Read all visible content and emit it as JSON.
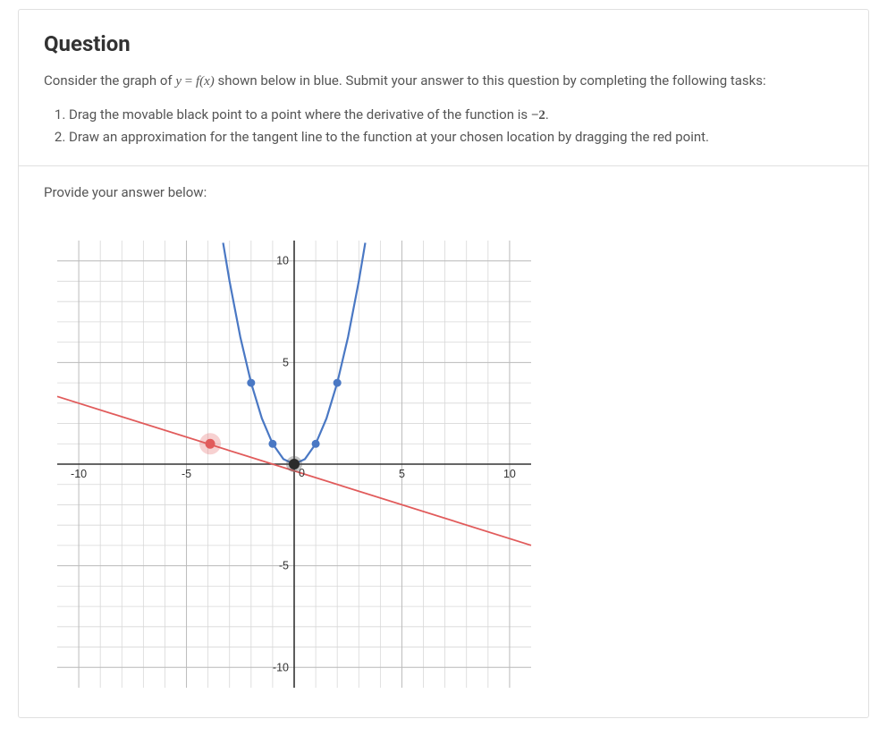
{
  "heading": "Question",
  "prompt_pre": "Consider the graph of ",
  "prompt_eq_lhs": "y",
  "prompt_eq_equals": " = ",
  "prompt_eq_rhs_f": "f",
  "prompt_eq_rhs_x": "(x)",
  "prompt_post": " shown below in blue. Submit your answer to this question by completing the following tasks:",
  "task1_pre": "Drag the movable black point to a point where the derivative of the function is ",
  "task1_val": "−2",
  "task1_post": ".",
  "task2": "Draw an approximation for the tangent line to the function at your chosen location by dragging the red point.",
  "provide": "Provide your answer below:",
  "chart_data": {
    "type": "line",
    "xlim": [
      -11,
      11
    ],
    "ylim": [
      -11,
      11
    ],
    "xticks_major": [
      -10,
      -5,
      0,
      5,
      10
    ],
    "yticks_major": [
      -10,
      -5,
      5,
      10
    ],
    "grid_minor_step": 1,
    "curve": {
      "color": "#4a78c4",
      "function": "y = x^2",
      "samples_x": [
        -3.3,
        -3,
        -2.5,
        -2,
        -1.5,
        -1,
        -0.5,
        0,
        0.5,
        1,
        1.5,
        2,
        2.5,
        3,
        3.3
      ],
      "samples_y": [
        10.89,
        9,
        6.25,
        4,
        2.25,
        1,
        0.25,
        0,
        0.25,
        1,
        2.25,
        4,
        6.25,
        9,
        10.89
      ]
    },
    "curve_markers": {
      "color": "#4a78c4",
      "points": [
        [
          -2,
          4
        ],
        [
          -1,
          1
        ],
        [
          0,
          0
        ],
        [
          1,
          1
        ],
        [
          2,
          4
        ]
      ]
    },
    "tangent_line": {
      "color": "#e15b5b",
      "slope": -0.333,
      "intercept": -0.333,
      "x_range": [
        -11,
        11
      ]
    },
    "black_point": {
      "x": 0,
      "y": 0
    },
    "red_point": {
      "x": -3.9,
      "y": 1
    }
  }
}
